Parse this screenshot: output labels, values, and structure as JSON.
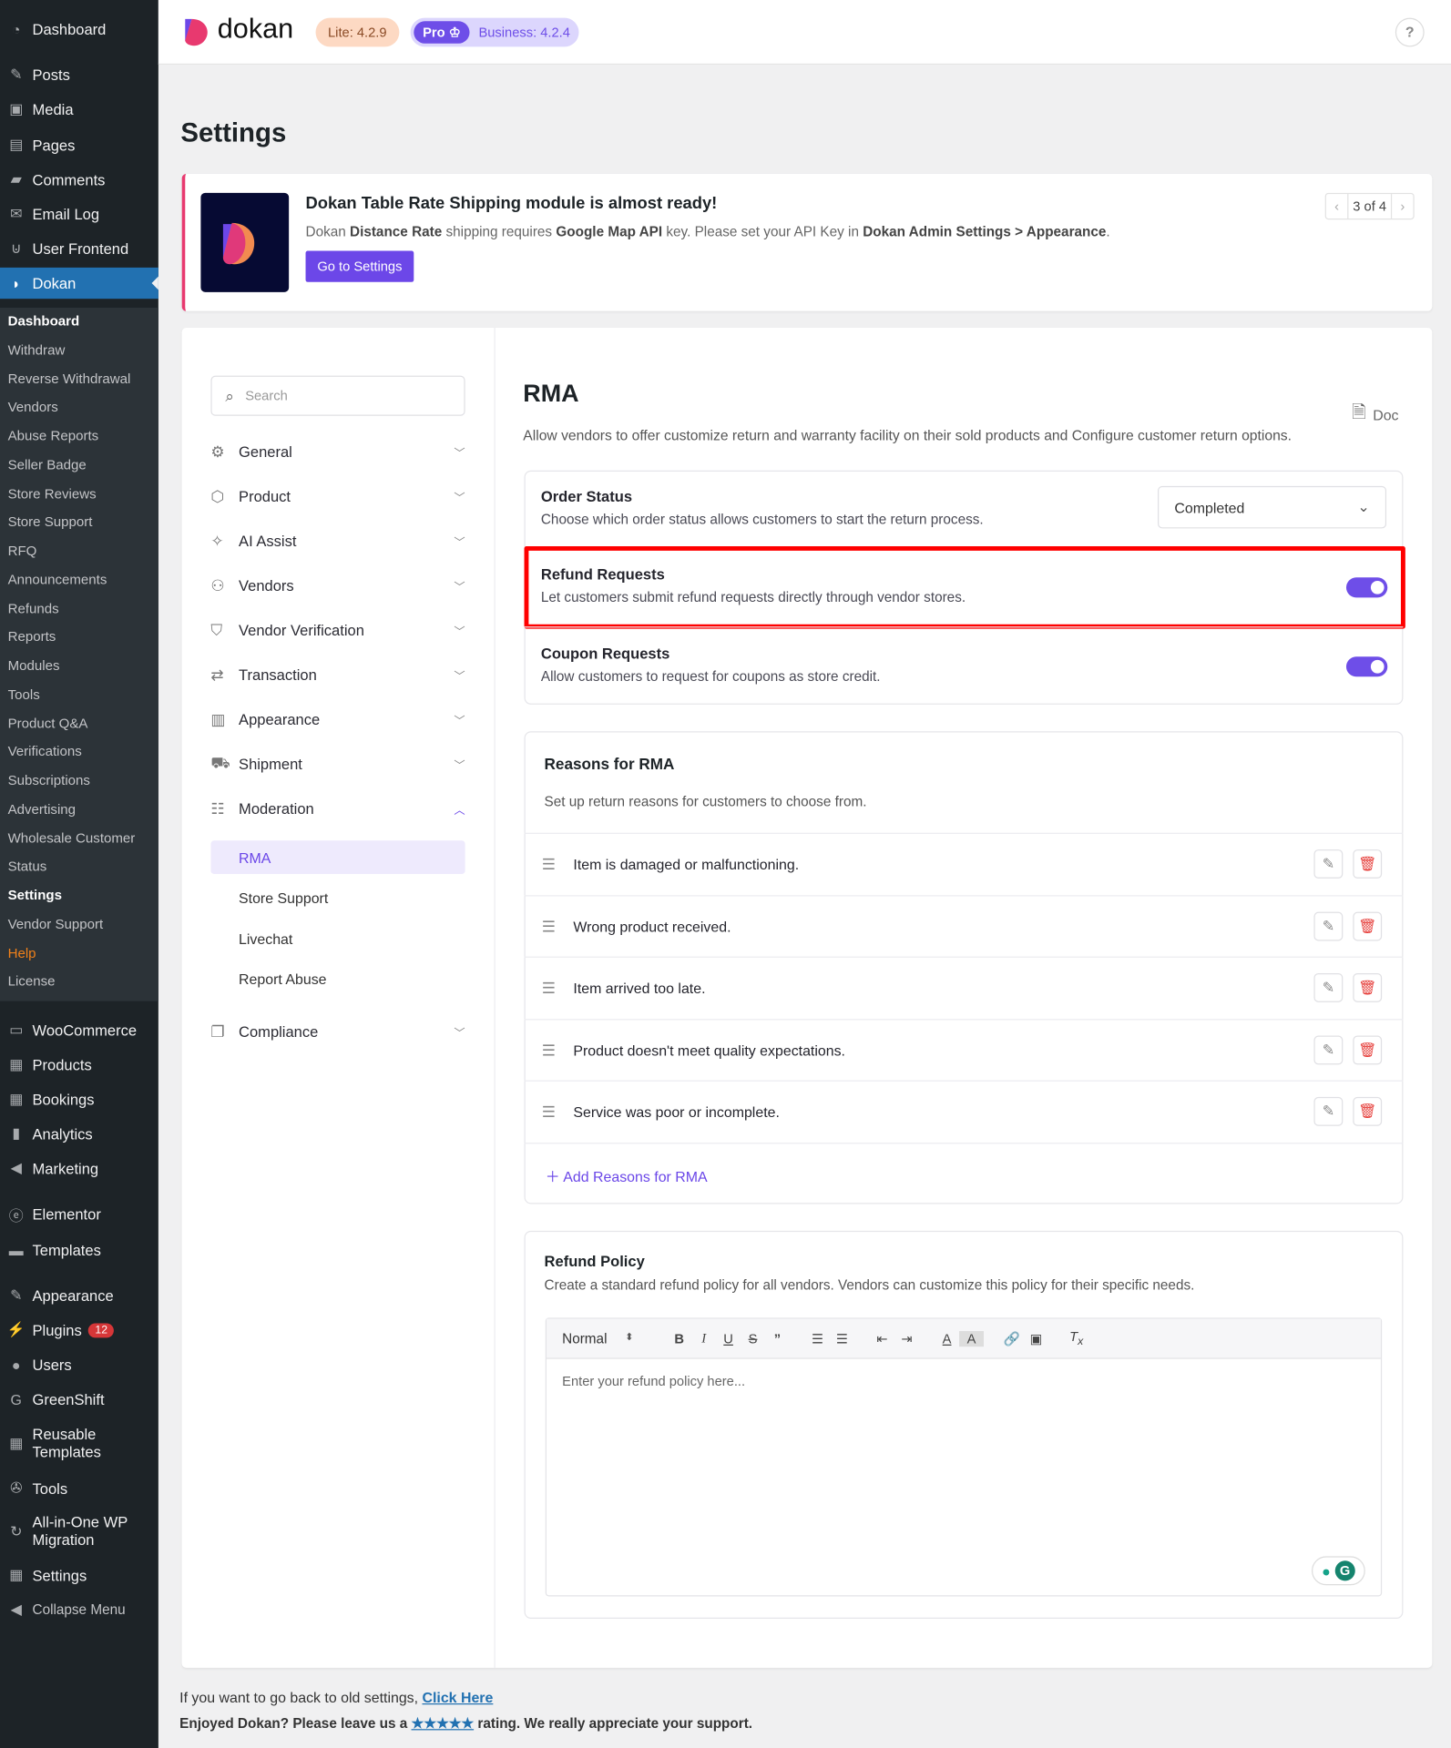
{
  "wp_menu": {
    "top": [
      {
        "label": "Dashboard",
        "icon": "dashboard-icon",
        "glyph": "◔"
      },
      {
        "label": "Posts",
        "icon": "pin-icon",
        "glyph": "✎"
      },
      {
        "label": "Media",
        "icon": "media-icon",
        "glyph": "▣"
      },
      {
        "label": "Pages",
        "icon": "pages-icon",
        "glyph": "▤"
      },
      {
        "label": "Comments",
        "icon": "comment-icon",
        "glyph": "▰"
      },
      {
        "label": "Email Log",
        "icon": "envelope-icon",
        "glyph": "✉"
      },
      {
        "label": "User Frontend",
        "icon": "user-frontend-icon",
        "glyph": "⊍"
      },
      {
        "label": "Dokan",
        "icon": "dokan-icon",
        "glyph": "◗"
      }
    ],
    "dokan_sub": [
      "Dashboard",
      "Withdraw",
      "Reverse Withdrawal",
      "Vendors",
      "Abuse Reports",
      "Seller Badge",
      "Store Reviews",
      "Store Support",
      "RFQ",
      "Announcements",
      "Refunds",
      "Reports",
      "Modules",
      "Tools",
      "Product Q&A",
      "Verifications",
      "Subscriptions",
      "Advertising",
      "Wholesale Customer",
      "Status",
      "Settings",
      "Vendor Support",
      "Help",
      "License"
    ],
    "bottom": [
      {
        "label": "WooCommerce",
        "icon": "woocommerce-icon",
        "glyph": "▭"
      },
      {
        "label": "Products",
        "icon": "products-icon",
        "glyph": "▦"
      },
      {
        "label": "Bookings",
        "icon": "calendar-icon",
        "glyph": "▦"
      },
      {
        "label": "Analytics",
        "icon": "bar-chart-icon",
        "glyph": "▮"
      },
      {
        "label": "Marketing",
        "icon": "megaphone-icon",
        "glyph": "◀"
      },
      {
        "label": "Elementor",
        "icon": "elementor-icon",
        "glyph": "ⓔ"
      },
      {
        "label": "Templates",
        "icon": "folder-icon",
        "glyph": "▬"
      },
      {
        "label": "Appearance",
        "icon": "brush-icon",
        "glyph": "✎"
      },
      {
        "label": "Plugins",
        "icon": "plug-icon",
        "glyph": "⚡",
        "badge": "12"
      },
      {
        "label": "Users",
        "icon": "user-icon",
        "glyph": "●"
      },
      {
        "label": "GreenShift",
        "icon": "greenshift-icon",
        "glyph": "G"
      },
      {
        "label": "Reusable Templates",
        "icon": "grid-icon",
        "glyph": "▦"
      },
      {
        "label": "Tools",
        "icon": "wrench-icon",
        "glyph": "✇"
      },
      {
        "label": "All-in-One WP Migration",
        "icon": "migration-icon",
        "glyph": "↻"
      },
      {
        "label": "Settings",
        "icon": "settings-icon",
        "glyph": "▦"
      },
      {
        "label": "Collapse Menu",
        "icon": "collapse-icon",
        "glyph": "◀"
      }
    ]
  },
  "header": {
    "brand": "dokan",
    "lite": "Lite: 4.2.9",
    "pro": "Pro",
    "business": "Business: 4.2.4",
    "help": "?"
  },
  "page_title": "Settings",
  "notice": {
    "title": "Dokan Table Rate Shipping module is almost ready!",
    "t1": "Dokan ",
    "b1": "Distance Rate",
    "t2": " shipping requires ",
    "b2": "Google Map API",
    "t3": " key. Please set your API Key in ",
    "b3": "Dokan Admin Settings > Appearance",
    "t4": ".",
    "button": "Go to Settings",
    "pager": "3 of 4"
  },
  "settings_nav": {
    "search_placeholder": "Search",
    "items": [
      {
        "label": "General",
        "icon": "gear-icon",
        "glyph": "⚙"
      },
      {
        "label": "Product",
        "icon": "box-icon",
        "glyph": "⬡"
      },
      {
        "label": "AI Assist",
        "icon": "sparkle-icon",
        "glyph": "✧"
      },
      {
        "label": "Vendors",
        "icon": "users-icon",
        "glyph": "⚇"
      },
      {
        "label": "Vendor Verification",
        "icon": "shield-icon",
        "glyph": "⛉"
      },
      {
        "label": "Transaction",
        "icon": "arrows-icon",
        "glyph": "⇄"
      },
      {
        "label": "Appearance",
        "icon": "layout-icon",
        "glyph": "▥"
      },
      {
        "label": "Shipment",
        "icon": "truck-icon",
        "glyph": "⛟"
      },
      {
        "label": "Moderation",
        "icon": "sliders-icon",
        "glyph": "☷"
      }
    ],
    "moderation_sub": [
      "RMA",
      "Store Support",
      "Livechat",
      "Report Abuse"
    ],
    "last": {
      "label": "Compliance",
      "icon": "copy-icon",
      "glyph": "❐"
    }
  },
  "rma": {
    "title": "RMA",
    "doc": "Doc",
    "description": "Allow vendors to offer customize return and warranty facility on their sold products and Configure customer return options.",
    "order_status": {
      "title": "Order Status",
      "desc": "Choose which order status allows customers to start the return process.",
      "value": "Completed"
    },
    "refund_requests": {
      "title": "Refund Requests",
      "desc": "Let customers submit refund requests directly through vendor stores.",
      "enabled": true
    },
    "coupon_requests": {
      "title": "Coupon Requests",
      "desc": "Allow customers to request for coupons as store credit.",
      "enabled": true
    },
    "reasons": {
      "title": "Reasons for RMA",
      "desc": "Set up return reasons for customers to choose from.",
      "items": [
        "Item is damaged or malfunctioning.",
        "Wrong product received.",
        "Item arrived too late.",
        "Product doesn't meet quality expectations.",
        "Service was poor or incomplete."
      ],
      "add": "Add Reasons for RMA"
    },
    "refund_policy": {
      "title": "Refund Policy",
      "desc": "Create a standard refund policy for all vendors. Vendors can customize this policy for their specific needs.",
      "format": "Normal",
      "placeholder": "Enter your refund policy here..."
    }
  },
  "footer": {
    "l1": "If you want to go back to old settings, ",
    "link": "Click Here",
    "l2a": "Enjoyed Dokan? Please leave us a ",
    "stars": "★★★★★",
    "l2b": " rating. We really appreciate your support."
  },
  "colors": {
    "accent": "#6e4ee8",
    "wp_active": "#2271b1",
    "highlight": "#ff0000",
    "delete": "#e53935"
  }
}
